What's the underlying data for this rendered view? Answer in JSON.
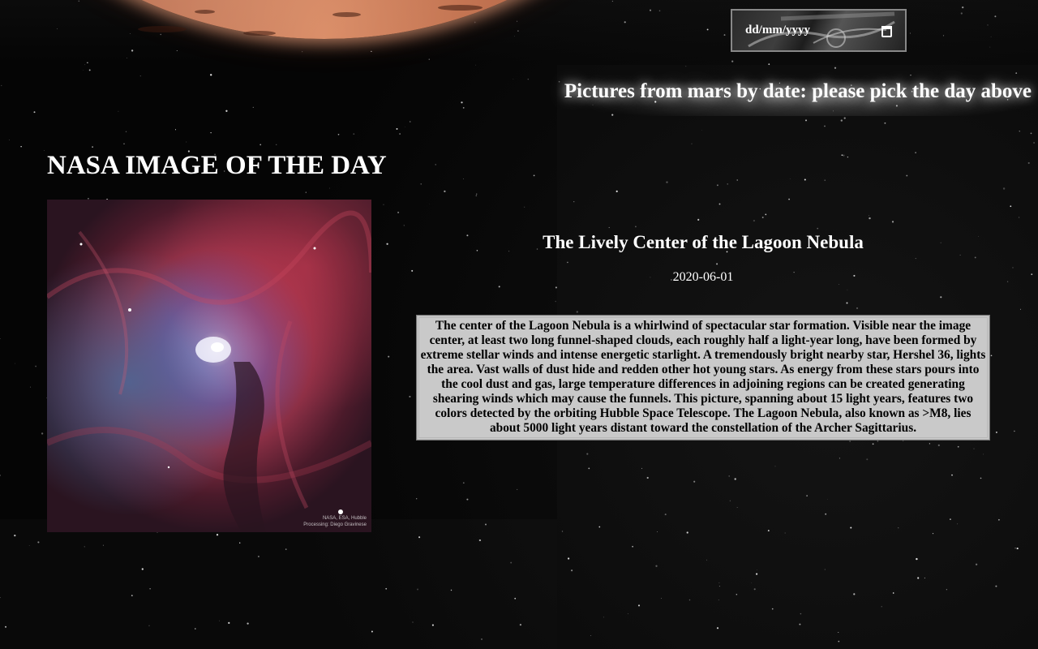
{
  "header": {
    "date_input": {
      "placeholder": "dd/mm/yyyy",
      "value": ""
    },
    "calendar_icon": "calendar-icon",
    "mars_heading": "Pictures from mars by date: please pick the day above"
  },
  "apod": {
    "section_title": "NASA IMAGE OF THE DAY",
    "image_credit": "NASA, ESA, Hubble\nProcessing: Diego Gravinese",
    "title": "The Lively Center of the Lagoon Nebula",
    "date": "2020-06-01",
    "explanation": "The center of the Lagoon Nebula is a whirlwind of spectacular star formation. Visible near the image center, at least two long funnel-shaped clouds, each roughly half a light-year long, have been formed by extreme stellar winds and intense energetic starlight. A tremendously bright nearby star, Hershel 36, lights the area. Vast walls of dust hide and redden other hot young stars. As energy from these stars pours into the cool dust and gas, large temperature differences in adjoining regions can be created generating shearing winds which may cause the funnels. This picture, spanning about 15 light years, features two colors detected by the orbiting Hubble Space Telescope. The Lagoon Nebula, also known as >M8, lies about 5000 light years distant toward the constellation of the Archer Sagittarius."
  },
  "colors": {
    "background": "#050505",
    "explanation_bg": "#c9c9c9",
    "mars": "#c7795a",
    "text": "#ffffff"
  }
}
